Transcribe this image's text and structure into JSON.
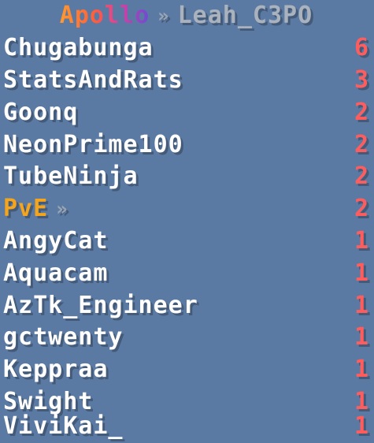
{
  "title": {
    "brand": "Apollo",
    "separator": "»",
    "user": "Leah_C3PO"
  },
  "players_top": [
    {
      "name": "Chugabunga",
      "score": "6"
    },
    {
      "name": "StatsAndRats",
      "score": "3"
    },
    {
      "name": "Goonq",
      "score": "2"
    },
    {
      "name": "NeonPrime100",
      "score": "2"
    },
    {
      "name": "TubeNinja",
      "score": "2"
    }
  ],
  "group": {
    "name": "PvE",
    "arrow": "»",
    "score": "2"
  },
  "players_bottom": [
    {
      "name": "AngyCat",
      "score": "1"
    },
    {
      "name": "Aquacam",
      "score": "1"
    },
    {
      "name": "AzTk_Engineer",
      "score": "1"
    },
    {
      "name": "gctwenty",
      "score": "1"
    },
    {
      "name": "Keppraa",
      "score": "1"
    },
    {
      "name": "Swight",
      "score": "1"
    },
    {
      "name": "ViviKai_",
      "score": "1"
    }
  ],
  "colors": {
    "background": "#5b7aa3",
    "name": "#ffffff",
    "score": "#ff5d5d",
    "group": "#f4a51c",
    "muted": "#aab2bd"
  }
}
